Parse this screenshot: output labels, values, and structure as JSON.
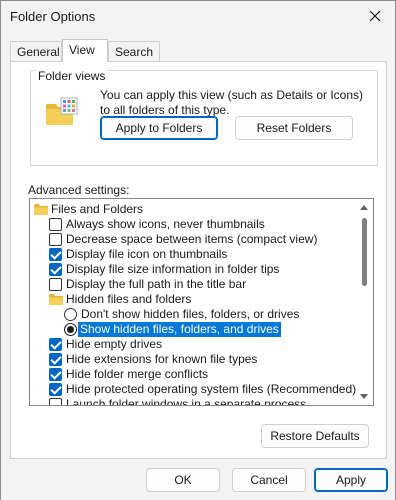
{
  "window": {
    "title": "Folder Options"
  },
  "tabs": [
    {
      "label": "General"
    },
    {
      "label": "View"
    },
    {
      "label": "Search"
    }
  ],
  "folder_views": {
    "group_label": "Folder views",
    "description": "You can apply this view (such as Details or Icons) to all folders of this type.",
    "apply_label": "Apply to Folders",
    "reset_label": "Reset Folders"
  },
  "advanced": {
    "label": "Advanced settings:",
    "items": [
      {
        "type": "folder",
        "level": 0,
        "label": "Files and Folders"
      },
      {
        "type": "checkbox",
        "level": 1,
        "checked": false,
        "label": "Always show icons, never thumbnails"
      },
      {
        "type": "checkbox",
        "level": 1,
        "checked": false,
        "label": "Decrease space between items (compact view)"
      },
      {
        "type": "checkbox",
        "level": 1,
        "checked": true,
        "label": "Display file icon on thumbnails"
      },
      {
        "type": "checkbox",
        "level": 1,
        "checked": true,
        "label": "Display file size information in folder tips"
      },
      {
        "type": "checkbox",
        "level": 1,
        "checked": false,
        "label": "Display the full path in the title bar"
      },
      {
        "type": "folder",
        "level": 1,
        "label": "Hidden files and folders"
      },
      {
        "type": "radio",
        "level": 2,
        "checked": false,
        "label": "Don't show hidden files, folders, or drives"
      },
      {
        "type": "radio",
        "level": 2,
        "checked": true,
        "selected": true,
        "label": "Show hidden files, folders, and drives"
      },
      {
        "type": "checkbox",
        "level": 1,
        "checked": true,
        "label": "Hide empty drives"
      },
      {
        "type": "checkbox",
        "level": 1,
        "checked": true,
        "label": "Hide extensions for known file types"
      },
      {
        "type": "checkbox",
        "level": 1,
        "checked": true,
        "label": "Hide folder merge conflicts"
      },
      {
        "type": "checkbox",
        "level": 1,
        "checked": true,
        "label": "Hide protected operating system files (Recommended)"
      },
      {
        "type": "checkbox",
        "level": 1,
        "checked": false,
        "label": "Launch folder windows in a separate process"
      }
    ],
    "restore_label": "Restore Defaults"
  },
  "footer": {
    "ok_label": "OK",
    "cancel_label": "Cancel",
    "apply_label": "Apply"
  },
  "colors": {
    "accent": "#0067c0",
    "selection": "#0078d7",
    "folder": "#f4c542"
  }
}
